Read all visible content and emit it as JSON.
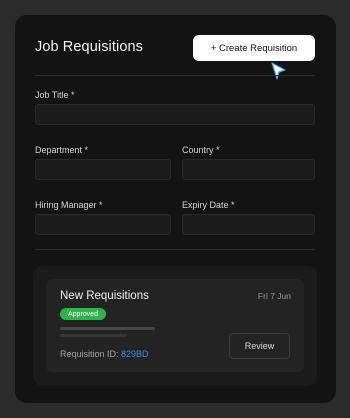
{
  "header": {
    "title": "Job Requisitions",
    "create_button_label": "+ Create Requisition"
  },
  "form": {
    "job_title_label": "Job Title *",
    "department_label": "Department *",
    "country_label": "Country *",
    "hiring_manager_label": "Hiring Manager *",
    "expiry_date_label": "Expiry Date *"
  },
  "requisition": {
    "title": "New Requisitions",
    "date": "Fri 7 Jun",
    "status": "Approved",
    "id_label": "Requisition ID: ",
    "id_value": "829BD",
    "review_button_label": "Review"
  },
  "colors": {
    "page_bg": "#2b2b2b",
    "card_bg": "#131313",
    "status_green": "#2eb34a",
    "id_blue": "#3b8fe8"
  },
  "icons": {
    "cursor": "mouse-pointer-icon"
  }
}
